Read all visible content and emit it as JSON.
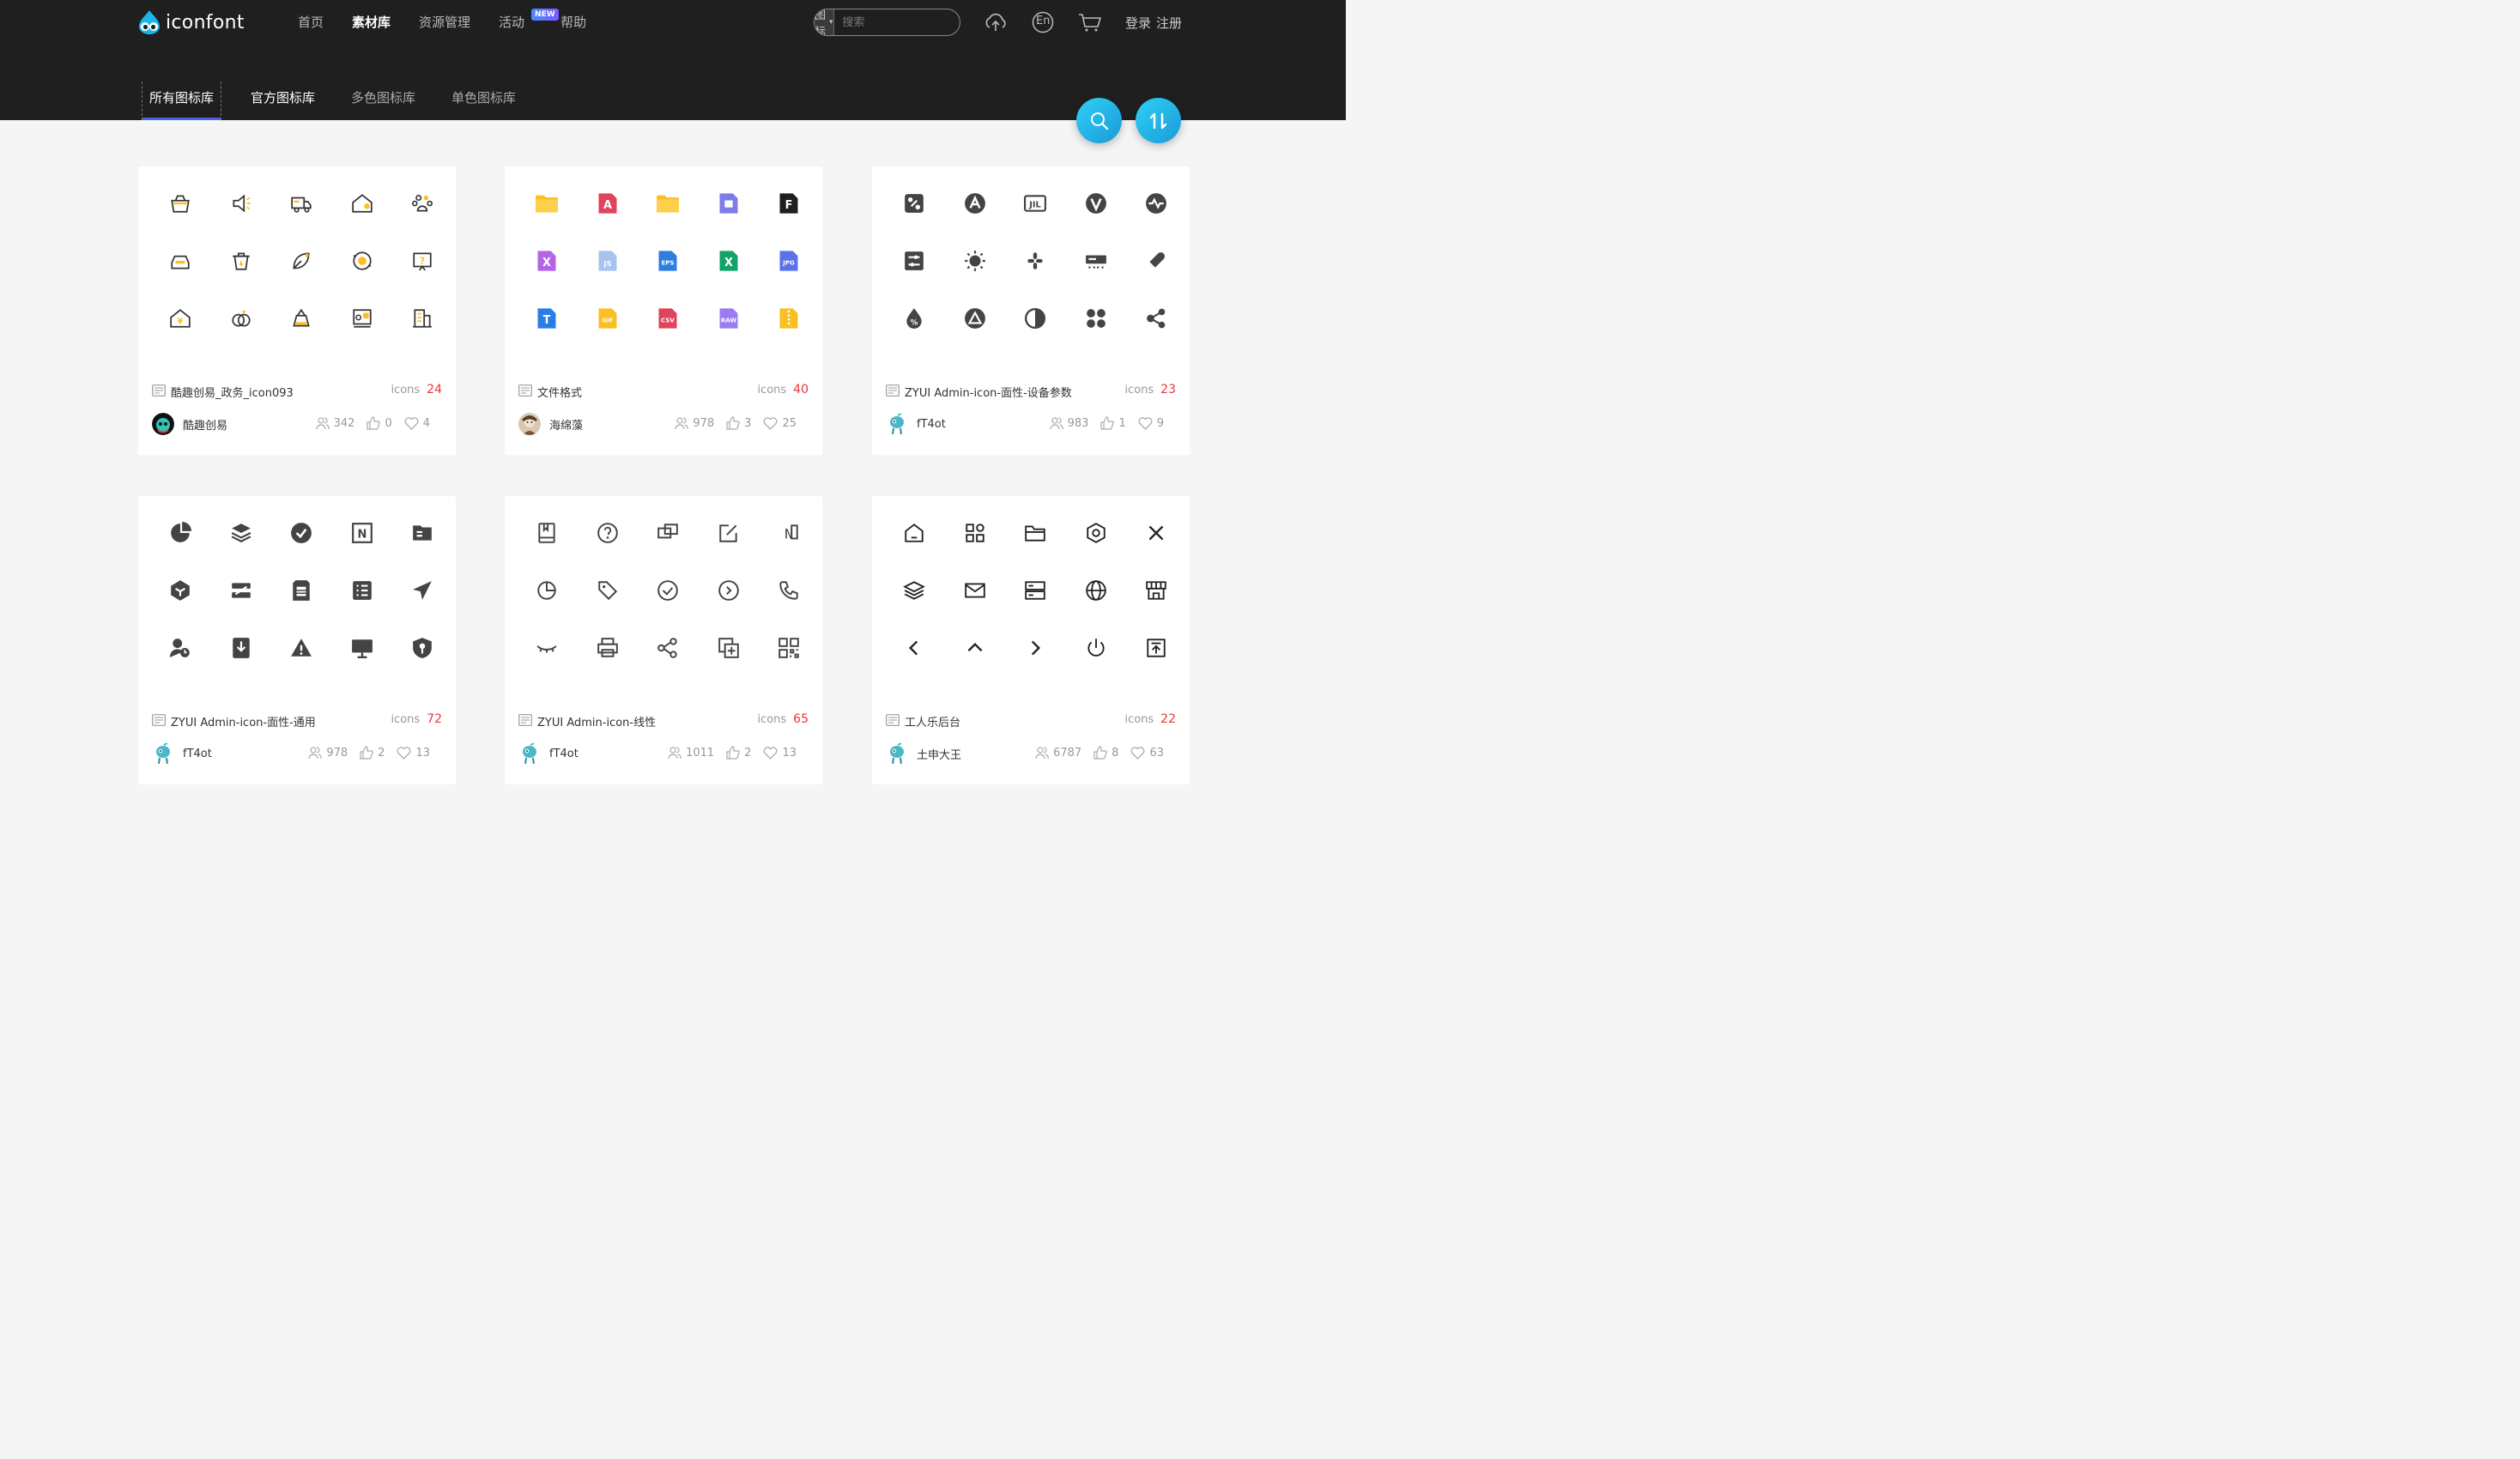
{
  "brand": {
    "name": "iconfont"
  },
  "nav": [
    {
      "label": "首页",
      "active": false
    },
    {
      "label": "素材库",
      "active": true
    },
    {
      "label": "资源管理",
      "active": false
    },
    {
      "label": "活动",
      "active": false,
      "badge": "NEW"
    },
    {
      "label": "帮助",
      "active": false
    }
  ],
  "search": {
    "type": "图标",
    "placeholder": "搜索"
  },
  "auth": {
    "login": "登录",
    "register": "注册"
  },
  "header_icons": [
    "upload-cloud-icon",
    "language-en-icon",
    "cart-icon"
  ],
  "language_label": "En",
  "subnav": [
    {
      "label": "所有图标库",
      "active": true
    },
    {
      "label": "官方图标库",
      "active": false
    },
    {
      "label": "多色图标库",
      "active": false
    },
    {
      "label": "单色图标库",
      "active": false
    }
  ],
  "fab": {
    "search": "search-icon",
    "sort": "sort-icon"
  },
  "cards": [
    {
      "title": "酷趣创易_政务_icon093",
      "count_label": "icons",
      "count": "24",
      "author": "酷趣创易",
      "collectors": "342",
      "likes": "0",
      "favorites": "4",
      "style": "yellow-outline",
      "icons": [
        "basket-icon",
        "megaphone-icon",
        "truck-icon",
        "house-icon",
        "paw-icon",
        "car-icon",
        "trash-icon",
        "leaf-chart-icon",
        "refresh-coin-icon",
        "question-board-icon",
        "home-yen-icon",
        "rings-icon",
        "stall-icon",
        "certificate-icon",
        "building-icon"
      ]
    },
    {
      "title": "文件格式",
      "count_label": "icons",
      "count": "40",
      "author": "海绵藻",
      "collectors": "978",
      "likes": "3",
      "favorites": "25",
      "style": "file-color",
      "icons": [
        {
          "name": "folder-icon",
          "color": "#fbbf24",
          "text": ""
        },
        {
          "name": "pdf-icon",
          "color": "#e0435c",
          "text": "A"
        },
        {
          "name": "folder-alt-icon",
          "color": "#fbbf24",
          "text": ""
        },
        {
          "name": "plugin-icon",
          "color": "#7d7ce8",
          "text": ""
        },
        {
          "name": "figma-icon",
          "color": "#1f1f1f",
          "text": "F"
        },
        {
          "name": "xd-icon",
          "color": "#b266e6",
          "text": "X"
        },
        {
          "name": "js-icon",
          "color": "#a7c4ef",
          "text": "JS"
        },
        {
          "name": "eps-icon",
          "color": "#2f7de1",
          "text": "EPS"
        },
        {
          "name": "excel-icon",
          "color": "#12a36a",
          "text": "X"
        },
        {
          "name": "jpg-icon",
          "color": "#5a73e8",
          "text": "JPG"
        },
        {
          "name": "txt-icon",
          "color": "#2a7de8",
          "text": "T"
        },
        {
          "name": "gif-icon",
          "color": "#fbbf24",
          "text": "GIF"
        },
        {
          "name": "csv-icon",
          "color": "#e0435c",
          "text": "CSV"
        },
        {
          "name": "raw-icon",
          "color": "#9b7cf0",
          "text": "RAW"
        },
        {
          "name": "zip-icon",
          "color": "#fbbf24",
          "text": ""
        }
      ]
    },
    {
      "title": "ZYUI Admin-icon-面性-设备参数",
      "count_label": "icons",
      "count": "23",
      "author": "fT4ot",
      "collectors": "983",
      "likes": "1",
      "favorites": "9",
      "style": "dark-solid",
      "icons": [
        "network-icon",
        "letter-a-circle-icon",
        "jil-icon",
        "letter-v-circle-icon",
        "pulse-icon",
        "toggle-list-icon",
        "brightness-icon",
        "slack-icon",
        "router-icon",
        "brush-icon",
        "drop-percent-icon",
        "triangle-circle-icon",
        "contrast-icon",
        "four-dots-icon",
        "share-nodes-icon"
      ]
    },
    {
      "title": "ZYUI Admin-icon-面性-通用",
      "count_label": "icons",
      "count": "72",
      "author": "fT4ot",
      "collectors": "978",
      "likes": "2",
      "favorites": "13",
      "style": "dark-solid",
      "icons": [
        "pie-chart-icon",
        "layers-icon",
        "check-circle-icon",
        "no-icon",
        "folder-file-icon",
        "cube-icon",
        "switch-icon",
        "sd-card-icon",
        "list-icon",
        "send-icon",
        "user-clock-icon",
        "download-tag-icon",
        "warning-icon",
        "monitor-icon",
        "shield-key-icon"
      ]
    },
    {
      "title": "ZYUI Admin-icon-线性",
      "count_label": "icons",
      "count": "65",
      "author": "fT4ot",
      "collectors": "1011",
      "likes": "2",
      "favorites": "13",
      "style": "dark-line",
      "icons": [
        "book-icon",
        "help-circle-icon",
        "copy-icon",
        "edit-icon",
        "no-line-icon",
        "pie-line-icon",
        "tag-icon",
        "check-circle-line-icon",
        "play-circle-icon",
        "phone-icon",
        "eye-closed-icon",
        "printer-icon",
        "share-icon",
        "add-copy-icon",
        "qrcode-icon"
      ]
    },
    {
      "title": "工人乐后台",
      "count_label": "icons",
      "count": "22",
      "author": "土申大王",
      "collectors": "6787",
      "likes": "8",
      "favorites": "63",
      "style": "black-line",
      "icons": [
        "home-icon",
        "apps-icon",
        "folder-line-icon",
        "hexagon-icon",
        "close-icon",
        "stack-icon",
        "mail-icon",
        "server-icon",
        "globe-icon",
        "shop-icon",
        "chevron-left-icon",
        "chevron-up-icon",
        "chevron-right-icon",
        "power-icon",
        "upload-box-icon"
      ]
    }
  ]
}
